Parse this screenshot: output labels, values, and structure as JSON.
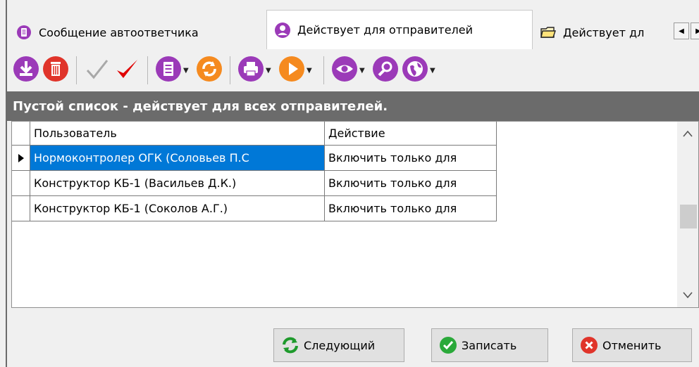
{
  "tabs": [
    {
      "label": "Сообщение автоответчика",
      "icon": "document-icon",
      "active": false
    },
    {
      "label": "Действует для отправителей",
      "icon": "user-icon",
      "active": true
    },
    {
      "label": "Действует дл",
      "icon": "folder-icon",
      "active": false
    }
  ],
  "toolbar": {
    "items": [
      "download-icon",
      "trash-icon",
      "check-gray-icon",
      "check-red-icon",
      "document-menu-icon",
      "refresh-icon",
      "print-icon",
      "play-icon",
      "eye-icon",
      "search-icon",
      "globe-icon"
    ]
  },
  "info_bar": "Пустой список - действует для всех отправителей.",
  "table": {
    "columns": [
      "Пользователь",
      "Действие"
    ],
    "rows": [
      {
        "user": "Нормоконтролер ОГК (Соловьев П.С",
        "action": "Включить только для",
        "selected": true
      },
      {
        "user": "Конструктор КБ-1 (Васильев Д.К.)",
        "action": "Включить только для",
        "selected": false
      },
      {
        "user": "Конструктор КБ-1 (Соколов А.Г.)",
        "action": "Включить только для",
        "selected": false
      }
    ]
  },
  "buttons": {
    "next": "Следующий",
    "save": "Записать",
    "cancel": "Отменить"
  },
  "colors": {
    "accent_purple": "#9b3ab8",
    "accent_red": "#e0342a",
    "accent_orange": "#f58a1f",
    "selection_blue": "#0078d7",
    "info_bar_gray": "#6b6b6b"
  }
}
